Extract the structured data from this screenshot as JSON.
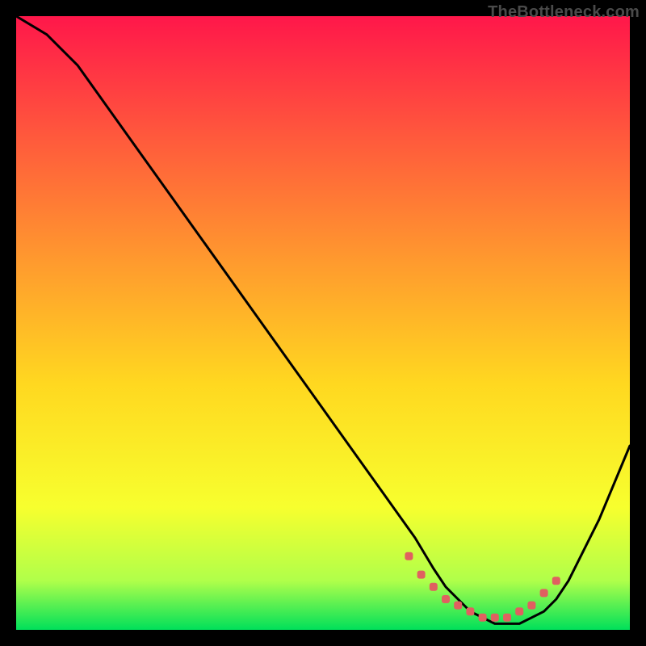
{
  "watermark": "TheBottleneck.com",
  "chart_data": {
    "type": "line",
    "title": "",
    "xlabel": "",
    "ylabel": "",
    "xlim": [
      0,
      100
    ],
    "ylim": [
      0,
      100
    ],
    "x": [
      0,
      5,
      10,
      15,
      20,
      25,
      30,
      35,
      40,
      45,
      50,
      55,
      60,
      65,
      68,
      70,
      72,
      74,
      76,
      78,
      80,
      82,
      84,
      86,
      88,
      90,
      95,
      100
    ],
    "values": [
      100,
      97,
      92,
      85,
      78,
      71,
      64,
      57,
      50,
      43,
      36,
      29,
      22,
      15,
      10,
      7,
      5,
      3,
      2,
      1,
      1,
      1,
      2,
      3,
      5,
      8,
      18,
      30
    ],
    "marker_points": {
      "x": [
        64,
        66,
        68,
        70,
        72,
        74,
        76,
        78,
        80,
        82,
        84,
        86,
        88
      ],
      "y": [
        12,
        9,
        7,
        5,
        4,
        3,
        2,
        2,
        2,
        3,
        4,
        6,
        8
      ]
    },
    "background_gradient": [
      "#ff174a",
      "#ff5a3c",
      "#ff9a2e",
      "#ffd820",
      "#f7ff2e",
      "#b0ff4a",
      "#00e05a"
    ],
    "curve_color": "#000000",
    "marker_color": "#e06060"
  }
}
